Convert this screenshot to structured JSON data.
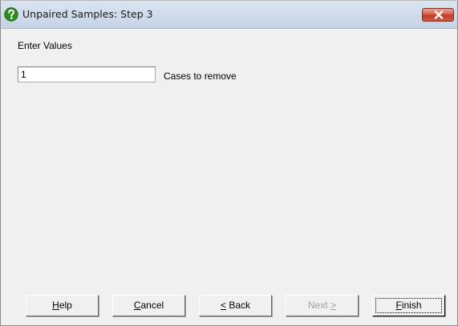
{
  "window": {
    "title": "Unpaired Samples: Step 3",
    "title_icon": "help-question-icon",
    "close_icon": "close-icon"
  },
  "form": {
    "section_label": "Enter Values",
    "cases_input_value": "1",
    "cases_input_caption": "Cases to remove"
  },
  "buttons": {
    "help": {
      "accel": "H",
      "rest": "elp",
      "enabled": true
    },
    "cancel": {
      "accel": "C",
      "rest": "ancel",
      "enabled": true
    },
    "back": {
      "accel": "<",
      "rest": " Back",
      "enabled": true
    },
    "next": {
      "pre": "Next ",
      "accel": ">",
      "enabled": false
    },
    "finish": {
      "accel": "F",
      "rest": "inish",
      "enabled": true,
      "default": true
    }
  },
  "colors": {
    "title_icon_fill": "#2e8b1f",
    "close_button": "#c8412c"
  }
}
